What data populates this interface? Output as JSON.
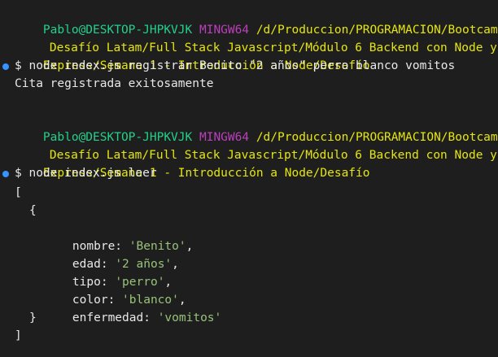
{
  "terminal": {
    "block1": {
      "prompt_user": "Pablo@DESKTOP-JHPKVJK",
      "prompt_shell": "MINGW64",
      "path_line1": "/d/Produccion/PROGRAMACION/Bootcamp",
      "path_line2": "Desafío Latam/Full Stack Javascript/Módulo 6 Backend con Node y",
      "path_line3": "",
      "command": "$ node index.js registrar Benito \"2 años\" perro blanco vomitos",
      "output": "Cita registrada exitosamente"
    },
    "block2": {
      "prompt_user": "Pablo@DESKTOP-JHPKVJK",
      "prompt_shell": "MINGW64",
      "path_line1": "/d/Produccion/PROGRAMACION/Bootcamp",
      "path_line2": "Desafío Latam/Full Stack Javascript/Módulo 6 Backend con Node y",
      "path_line3": "Express/Semana 1 - Introducción a Node/Desafío",
      "command": "$ node index.js leer"
    },
    "output": {
      "open_bracket": "[",
      "open_brace": "{",
      "fields": [
        {
          "key": "nombre: ",
          "value": "'Benito'",
          "suffix": ","
        },
        {
          "key": "edad: ",
          "value": "'2 años'",
          "suffix": ","
        },
        {
          "key": "tipo: ",
          "value": "'perro'",
          "suffix": ","
        },
        {
          "key": "color: ",
          "value": "'blanco'",
          "suffix": ","
        },
        {
          "key": "enfermedad: ",
          "value": "'vomitos'",
          "suffix": ""
        }
      ],
      "close_brace": "}",
      "close_bracket": "]"
    }
  },
  "colors": {
    "background": "#1e1e1e",
    "user": "#23d18b",
    "shell": "#bc3fbc",
    "path": "#e5e510",
    "string": "#98c379",
    "dot": "#3794ff"
  }
}
